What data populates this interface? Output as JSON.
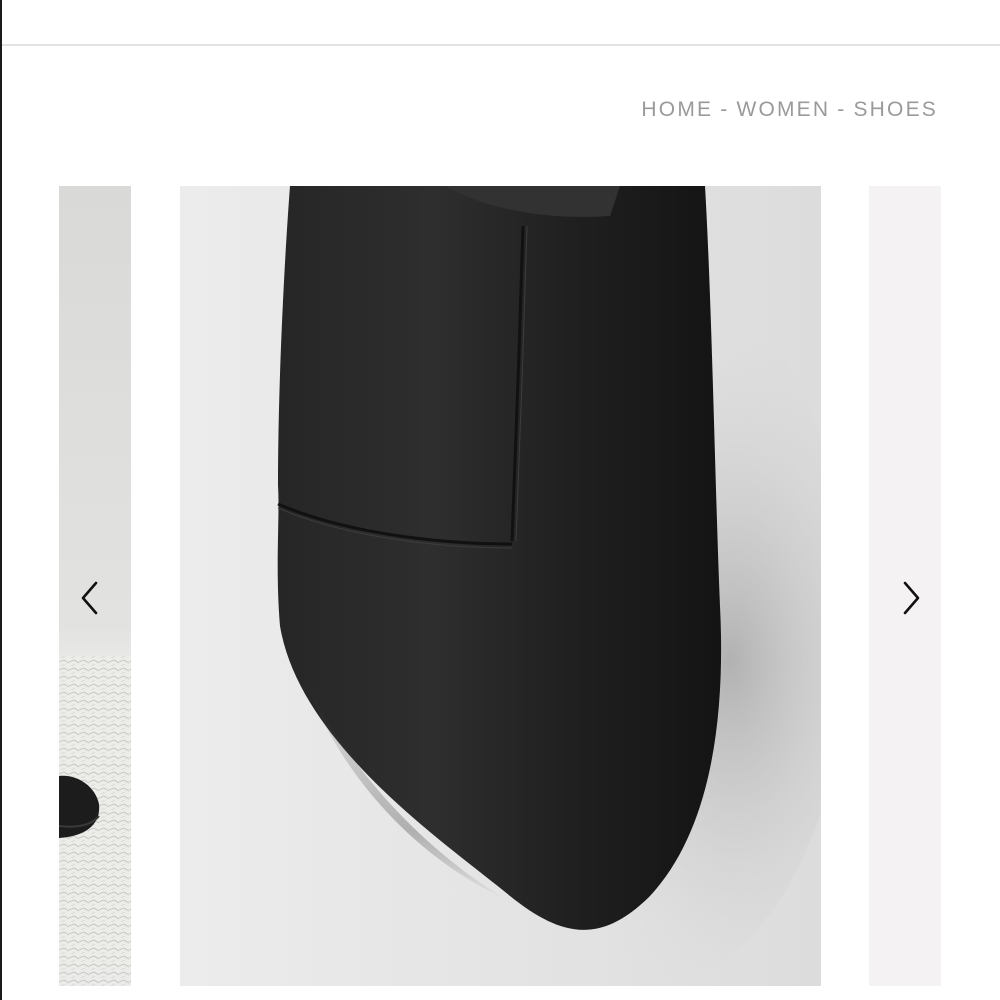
{
  "breadcrumb": {
    "items": [
      "HOME",
      "WOMEN",
      "SHOES"
    ],
    "separator": "-"
  },
  "carousel": {
    "prev_icon": "chevron-left-icon",
    "next_icon": "chevron-right-icon",
    "slides": [
      {
        "name": "previous-slide-image",
        "content": "boot on textured rug"
      },
      {
        "name": "current-slide-image",
        "content": "black leather ankle boot close-up"
      },
      {
        "name": "next-slide-image",
        "content": "light placeholder"
      }
    ]
  },
  "colors": {
    "breadcrumb_text": "#9a9a9a",
    "divider": "#e3e3e3",
    "boot_leather": "#1f1f1f",
    "backdrop": "#e6e6e6"
  }
}
